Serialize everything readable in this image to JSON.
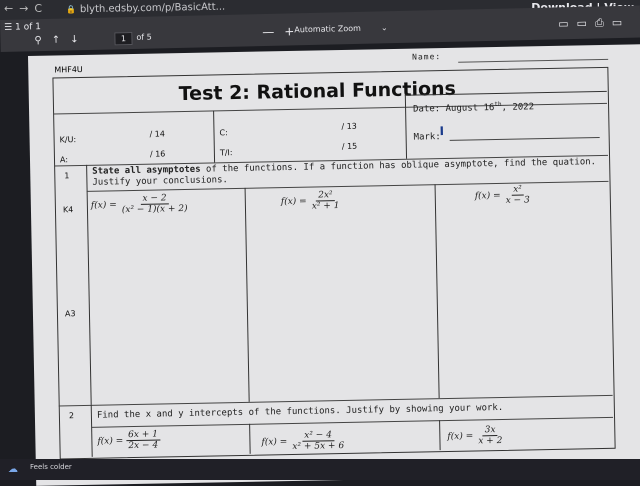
{
  "browser": {
    "nav_glyphs": "←→C",
    "url": "blyth.edsby.com/p/BasicAtt...",
    "download_label": "Download | View"
  },
  "toolbar": {
    "page_label": "1 of 1",
    "page_number": "1",
    "of_pages": "of 5",
    "zoom_minus": "—",
    "zoom_plus": "+",
    "zoom_select": "Automatic Zoom"
  },
  "paper": {
    "course": "MHF4U",
    "name_label": "Name:",
    "title": "Test 2: Rational Functions",
    "date_label": "Date: August 16",
    "date_sup": "th",
    "date_year": ", 2022",
    "mark_label": "Mark:",
    "scores": [
      {
        "label": "K/U:",
        "total": "/ 14"
      },
      {
        "label": "C:",
        "total": "/ 13"
      },
      {
        "label": "A:",
        "total": "/ 16"
      },
      {
        "label": "T/I:",
        "total": "/ 15"
      }
    ],
    "q1": {
      "number": "1",
      "text_bold": "State all asymptotes",
      "text_rest": " of the functions. If a function has oblique asymptote, find the quation. Justify your conclusions.",
      "category_a": "K4",
      "category_b": "A3",
      "functions": [
        {
          "fx": "f(x) =",
          "num": "x − 2",
          "den": "(x² − 1)(x + 2)"
        },
        {
          "fx": "f(x) =",
          "num": "2x²",
          "den": "x² + 1"
        },
        {
          "fx": "f(x) =",
          "num": "x²",
          "den": "x − 3"
        }
      ]
    },
    "q2": {
      "number": "2",
      "text": "Find the x and y intercepts of the functions. Justify by showing your work.",
      "functions": [
        {
          "fx": "f(x) =",
          "num": "6x + 1",
          "den": "2x − 4"
        },
        {
          "fx": "f(x) =",
          "num": "x² − 4",
          "den": "x² + 5x + 6"
        },
        {
          "fx": "f(x) =",
          "num": "3x",
          "den": "x + 2"
        }
      ]
    }
  },
  "taskbar": {
    "weather_text": "Feels colder"
  }
}
